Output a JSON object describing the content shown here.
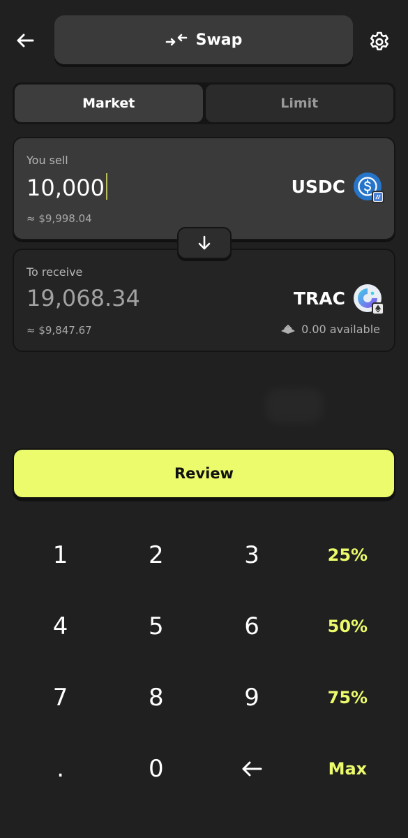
{
  "header": {
    "back_icon": "arrow-left-icon",
    "title": "Swap",
    "title_icon": "swap-arrows-icon",
    "settings_icon": "gear-icon"
  },
  "tabs": [
    {
      "label": "Market",
      "active": true
    },
    {
      "label": "Limit",
      "active": false
    }
  ],
  "sell": {
    "label": "You sell",
    "amount": "10,000",
    "usd_value": "≈ $9,998.04",
    "token_symbol": "USDC",
    "token_icon": "usdc-logo-icon",
    "chain_icon": "chain-badge-icon"
  },
  "flip_icon": "arrow-down-icon",
  "receive": {
    "label": "To receive",
    "amount": "19,068.34",
    "usd_value": "≈ $9,847.67",
    "token_symbol": "TRAC",
    "token_icon": "trac-logo-icon",
    "chain_icon": "ethereum-icon",
    "available": "0.00 available",
    "wallet_icon": "wallet-icon"
  },
  "review_label": "Review",
  "keypad": {
    "k1": "1",
    "k2": "2",
    "k3": "3",
    "p25": "25%",
    "k4": "4",
    "k5": "5",
    "k6": "6",
    "p50": "50%",
    "k7": "7",
    "k8": "8",
    "k9": "9",
    "p75": "75%",
    "dot": ".",
    "k0": "0",
    "backspace_icon": "backspace-arrow-icon",
    "max": "Max"
  },
  "colors": {
    "background": "#202020",
    "accent": "#ecfb6b",
    "card_active": "#3a3a3a",
    "card_inactive": "#242424",
    "usdc_blue": "#2775ca",
    "trac_gradient": [
      "#3fd1e8",
      "#8a4cf0"
    ]
  }
}
